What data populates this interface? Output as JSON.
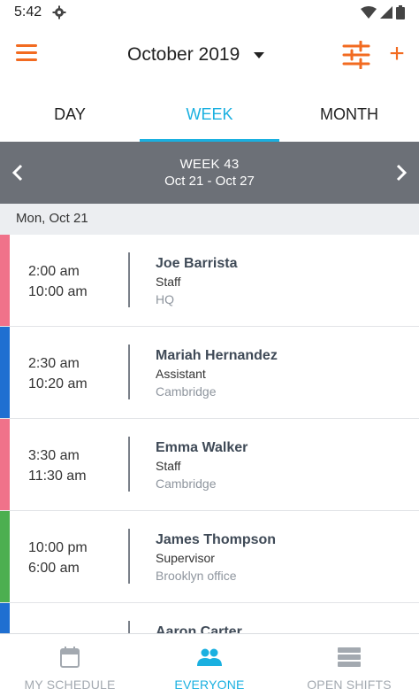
{
  "status_bar": {
    "time": "5:42"
  },
  "header": {
    "month_label": "October 2019"
  },
  "tabs": [
    {
      "label": "DAY",
      "active": false
    },
    {
      "label": "WEEK",
      "active": true
    },
    {
      "label": "MONTH",
      "active": false
    }
  ],
  "week_nav": {
    "week_label": "WEEK 43",
    "range": "Oct 21 - Oct 27"
  },
  "day_header": "Mon, Oct 21",
  "shifts": [
    {
      "start": "2:00 am",
      "end": "10:00 am",
      "name": "Joe Barrista",
      "role": "Staff",
      "location": "HQ",
      "color": "#f0728a"
    },
    {
      "start": "2:30 am",
      "end": "10:20 am",
      "name": "Mariah Hernandez",
      "role": "Assistant",
      "location": "Cambridge",
      "color": "#1f6fd1"
    },
    {
      "start": "3:30 am",
      "end": "11:30 am",
      "name": "Emma Walker",
      "role": "Staff",
      "location": "Cambridge",
      "color": "#f0728a"
    },
    {
      "start": "10:00 pm",
      "end": "6:00 am",
      "name": "James Thompson",
      "role": "Supervisor",
      "location": "Brooklyn office",
      "color": "#4caf50"
    },
    {
      "start": "",
      "end": "",
      "name": "Aaron Carter",
      "role": "",
      "location": "",
      "color": "#1f6fd1"
    }
  ],
  "bottom_nav": [
    {
      "label": "MY SCHEDULE",
      "icon": "calendar-icon",
      "active": false
    },
    {
      "label": "EVERYONE",
      "icon": "people-icon",
      "active": true
    },
    {
      "label": "OPEN SHIFTS",
      "icon": "stack-icon",
      "active": false
    }
  ],
  "colors": {
    "accent": "#f26b21",
    "active_tab": "#1ab0e0",
    "week_bar": "#6c7077"
  }
}
